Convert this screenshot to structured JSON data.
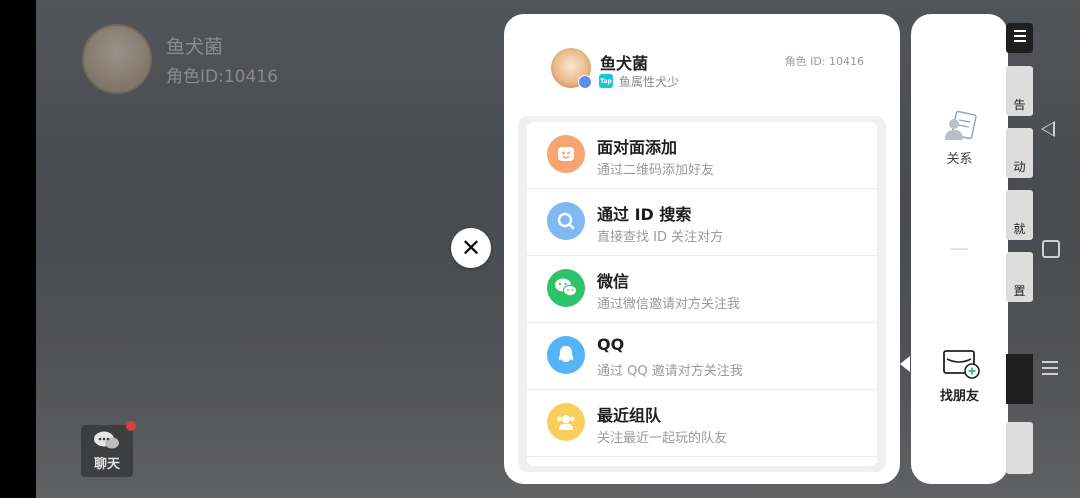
{
  "background": {
    "user_name": "鱼犬菌",
    "user_role_id": "角色ID:10416",
    "chat_label": "聊天",
    "side_buttons": [
      "告",
      "动",
      "就",
      "置"
    ]
  },
  "profile": {
    "name": "鱼犬菌",
    "tap_tag": "Tap",
    "subtitle": "鱼属性犬少",
    "role_id": "角色 ID: 10416"
  },
  "add_options": [
    {
      "title": "面对面添加",
      "subtitle": "通过二维码添加好友",
      "icon": "face-to-face-icon",
      "color": "#f6a472"
    },
    {
      "title": "通过 ID 搜索",
      "subtitle": "直接查找 ID 关注对方",
      "icon": "search-icon",
      "color": "#7fb8f2"
    },
    {
      "title": "微信",
      "subtitle": "通过微信邀请对方关注我",
      "icon": "wechat-icon",
      "color": "#2ec36a"
    },
    {
      "title": "QQ",
      "subtitle": "通过 QQ 邀请对方关注我",
      "icon": "qq-icon",
      "color": "#53b5f5"
    },
    {
      "title": "最近组队",
      "subtitle": "关注最近一起玩的队友",
      "icon": "recent-team-icon",
      "color": "#f8cf5d"
    }
  ],
  "right_nav": {
    "relations_label": "关系",
    "find_friends_label": "找朋友"
  }
}
